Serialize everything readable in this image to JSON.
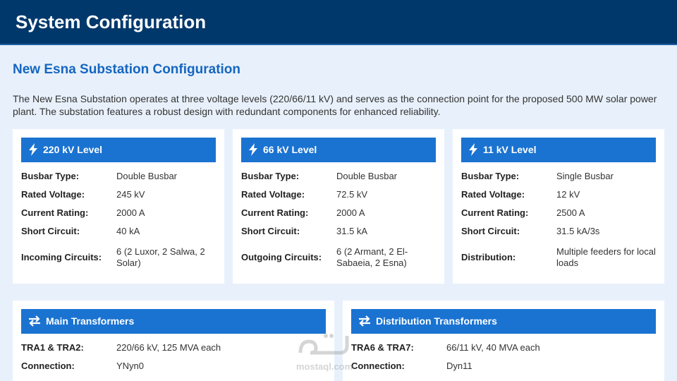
{
  "header": {
    "title": "System Configuration"
  },
  "section": {
    "title": "New Esna Substation Configuration",
    "intro": "The New Esna Substation operates at three voltage levels (220/66/11 kV) and serves as the connection point for the proposed 500 MW solar power plant. The substation features a robust design with redundant components for enhanced reliability."
  },
  "cards": [
    {
      "icon": "bolt-icon",
      "title": "220 kV Level",
      "rows": [
        {
          "key": "Busbar Type:",
          "value": "Double Busbar"
        },
        {
          "key": "Rated Voltage:",
          "value": "245 kV"
        },
        {
          "key": "Current Rating:",
          "value": "2000 A"
        },
        {
          "key": "Short Circuit:",
          "value": "40 kA"
        },
        {
          "key": "Incoming Circuits:",
          "value": "6 (2 Luxor, 2 Salwa, 2 Solar)"
        }
      ]
    },
    {
      "icon": "bolt-icon",
      "title": "66 kV Level",
      "rows": [
        {
          "key": "Busbar Type:",
          "value": "Double Busbar"
        },
        {
          "key": "Rated Voltage:",
          "value": "72.5 kV"
        },
        {
          "key": "Current Rating:",
          "value": "2000 A"
        },
        {
          "key": "Short Circuit:",
          "value": "31.5 kA"
        },
        {
          "key": "Outgoing Circuits:",
          "value": "6 (2 Armant, 2 El-Sabaeia, 2 Esna)"
        }
      ]
    },
    {
      "icon": "bolt-icon",
      "title": "11 kV Level",
      "rows": [
        {
          "key": "Busbar Type:",
          "value": "Single Busbar"
        },
        {
          "key": "Rated Voltage:",
          "value": "12 kV"
        },
        {
          "key": "Current Rating:",
          "value": "2500 A"
        },
        {
          "key": "Short Circuit:",
          "value": "31.5 kA/3s"
        },
        {
          "key": "Distribution:",
          "value": "Multiple feeders for local loads"
        }
      ]
    },
    {
      "icon": "swap-arrows-icon",
      "title": "Main Transformers",
      "rows": [
        {
          "key": "TRA1 & TRA2:",
          "value": "220/66 kV, 125 MVA each"
        },
        {
          "key": "Connection:",
          "value": "YNyn0"
        }
      ]
    },
    {
      "icon": "swap-arrows-icon",
      "title": "Distribution Transformers",
      "rows": [
        {
          "key": "TRA6 & TRA7:",
          "value": "66/11 kV, 40 MVA each"
        },
        {
          "key": "Connection:",
          "value": "Dyn11"
        }
      ]
    }
  ],
  "watermark": {
    "text": "mostaql.com"
  },
  "colors": {
    "header_bg": "#00386b",
    "accent": "#1a73d1",
    "title": "#1566c0",
    "page_bg": "#e8f1fb"
  }
}
